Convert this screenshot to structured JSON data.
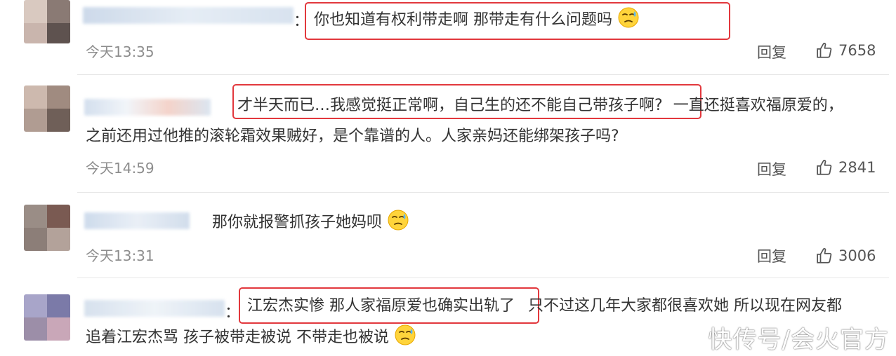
{
  "comments": [
    {
      "text_line1_highlight": "你也知道有权利带走啊 那带走有什么问题吗",
      "time": "今天13:35",
      "reply_label": "回复",
      "likes": "7658"
    },
    {
      "text_line1_highlight": "才半天而已…我感觉挺正常啊，自己生的还不能自己带孩子啊?",
      "text_line1_rest": "一直还挺喜欢福原爱的，",
      "text_line2": "之前还用过他推的滚轮霜效果贼好，是个靠谱的人。人家亲妈还能绑架孩子吗?",
      "time": "今天14:59",
      "reply_label": "回复",
      "likes": "2841"
    },
    {
      "text_line1": "那你就报警抓孩子她妈呗",
      "time": "今天13:31",
      "reply_label": "回复",
      "likes": "3006"
    },
    {
      "text_line1_highlight": "江宏杰实惨 那人家福原爱也确实出轨了",
      "text_line1_rest": "只不过这几年大家都很喜欢她 所以现在网友都",
      "text_line2": "追着江宏杰骂 孩子被带走被说 不带走也被说"
    }
  ],
  "colon": "：",
  "watermark": "快传号/会火官方",
  "colors": {
    "highlight_border": "#e2383d",
    "time_text": "#8d8d8d"
  }
}
